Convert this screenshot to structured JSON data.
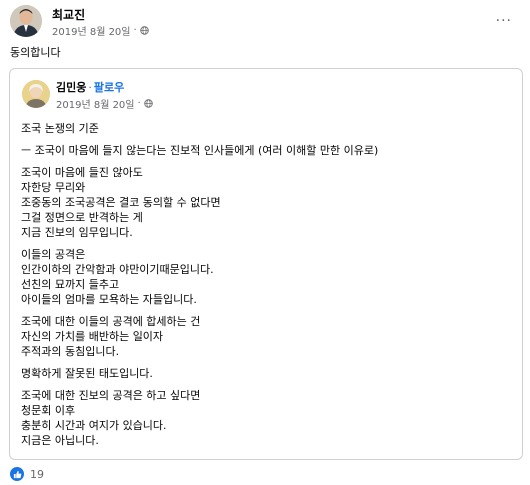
{
  "post": {
    "author": "최교진",
    "date": "2019년 8월 20일",
    "date_sep": "·",
    "audience_icon": "globe-icon",
    "more_icon": "more-options-icon",
    "more_label": "···",
    "text": "동의합니다"
  },
  "shared": {
    "author": "김민웅",
    "dot": "·",
    "follow_label": "팔로우",
    "date": "2019년 8월 20일",
    "date_sep": "·",
    "paragraphs": [
      [
        "조국 논쟁의 기준"
      ],
      [
        "ㅡ 조국이 마음에 들지 않는다는 진보적 인사들에게 (여러 이해할 만한 이유로)"
      ],
      [
        "조국이 마음에 들진 않아도",
        "자한당 무리와",
        "조중동의 조국공격은 결코 동의할 수 없다면",
        "그걸 정면으로 반격하는 게",
        "지금 진보의 임무입니다."
      ],
      [
        "이들의 공격은",
        "인간이하의 간악함과 야만이기때문입니다.",
        "선친의 묘까지 들추고",
        "아이들의 엄마를 모욕하는 자들입니다."
      ],
      [
        "조국에 대한 이들의 공격에 합세하는 건",
        "자신의 가치를 배반하는 일이자",
        "주적과의 동침입니다."
      ],
      [
        "명확하게 잘못된 태도입니다."
      ],
      [
        "조국에 대한 진보의 공격은 하고 싶다면",
        "청문회 이후",
        "충분히 시간과 여지가 있습니다.",
        "지금은 아닙니다."
      ]
    ]
  },
  "reactions": {
    "icon": "like-icon",
    "count": "19",
    "color": "#1b74e4"
  }
}
